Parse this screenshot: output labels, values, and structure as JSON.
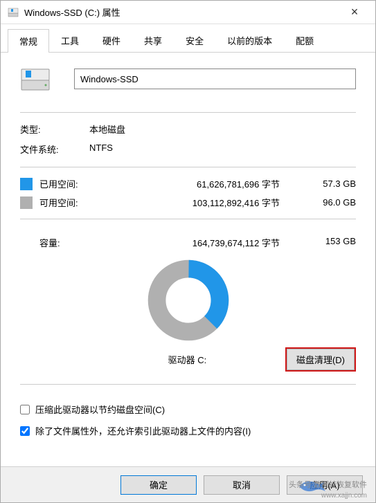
{
  "titlebar": {
    "title": "Windows-SSD (C:) 属性"
  },
  "tabs": {
    "items": [
      {
        "label": "常规"
      },
      {
        "label": "工具"
      },
      {
        "label": "硬件"
      },
      {
        "label": "共享"
      },
      {
        "label": "安全"
      },
      {
        "label": "以前的版本"
      },
      {
        "label": "配额"
      }
    ],
    "active_index": 0
  },
  "drive": {
    "name_value": "Windows-SSD",
    "type_label": "类型:",
    "type_value": "本地磁盘",
    "fs_label": "文件系统:",
    "fs_value": "NTFS"
  },
  "space": {
    "used_label": "已用空间:",
    "used_bytes": "61,626,781,696 字节",
    "used_gb": "57.3 GB",
    "free_label": "可用空间:",
    "free_bytes": "103,112,892,416 字节",
    "free_gb": "96.0 GB",
    "cap_label": "容量:",
    "cap_bytes": "164,739,674,112 字节",
    "cap_gb": "153 GB"
  },
  "chart_data": {
    "type": "pie",
    "title": "驱动器 C:",
    "series": [
      {
        "name": "已用空间",
        "value": 57.3,
        "color": "#2196e8"
      },
      {
        "name": "可用空间",
        "value": 96.0,
        "color": "#b0b0b0"
      }
    ],
    "unit": "GB"
  },
  "drive_label": "驱动器 C:",
  "cleanup_button": "磁盘清理(D)",
  "checkboxes": {
    "compress": {
      "label": "压缩此驱动器以节约磁盘空间(C)",
      "checked": false
    },
    "index": {
      "label": "除了文件属性外，还允许索引此驱动器上文件的内容(I)",
      "checked": true
    }
  },
  "footer": {
    "ok": "确定",
    "cancel": "取消",
    "apply": "应用(A)"
  },
  "watermark": {
    "line1": "头条号:数据蛙恢复软件",
    "line2": "www.xajjn.com"
  }
}
